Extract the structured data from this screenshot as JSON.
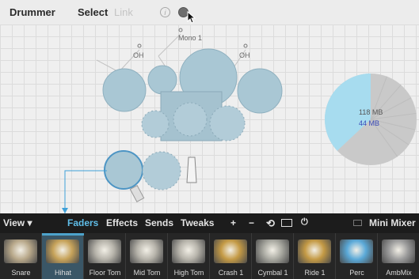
{
  "toolbar": {
    "app_name": "Drummer",
    "select_label": "Select",
    "link_label": "Link",
    "info_icon": "i"
  },
  "canvas": {
    "mono_label": "Mono 1",
    "oh_left": "OH",
    "oh_right": "OH"
  },
  "memory": {
    "total": "118 MB",
    "used": "44 MB",
    "used_fraction": 0.37,
    "colors": {
      "used": "#a7dcef",
      "free": "#c9c9c9"
    }
  },
  "mixer": {
    "view_label": "View ▾",
    "tabs": [
      "Faders",
      "Effects",
      "Sends",
      "Tweaks"
    ],
    "active_tab": "Faders",
    "add_label": "+",
    "remove_label": "−",
    "mini_mixer_label": "Mini Mixer",
    "channels": [
      {
        "label": "Snare",
        "selected": false,
        "color": "#b8a88a"
      },
      {
        "label": "Hihat",
        "selected": true,
        "color": "#c7a35a"
      },
      {
        "label": "Floor Tom",
        "selected": false,
        "color": "#b6b3aa"
      },
      {
        "label": "Mid Tom",
        "selected": false,
        "color": "#b6b3aa"
      },
      {
        "label": "High Tom",
        "selected": false,
        "color": "#b6b3aa"
      },
      {
        "label": "Crash 1",
        "selected": false,
        "color": "#c49a45"
      },
      {
        "label": "Cymbal 1",
        "selected": false,
        "color": "#a8a8a0"
      },
      {
        "label": "Ride 1",
        "selected": false,
        "color": "#c49a45"
      },
      {
        "label": "Perc",
        "selected": false,
        "color": "#5aa9d8"
      },
      {
        "label": "AmbMix",
        "selected": false,
        "color": "#9c9c9c"
      }
    ]
  }
}
